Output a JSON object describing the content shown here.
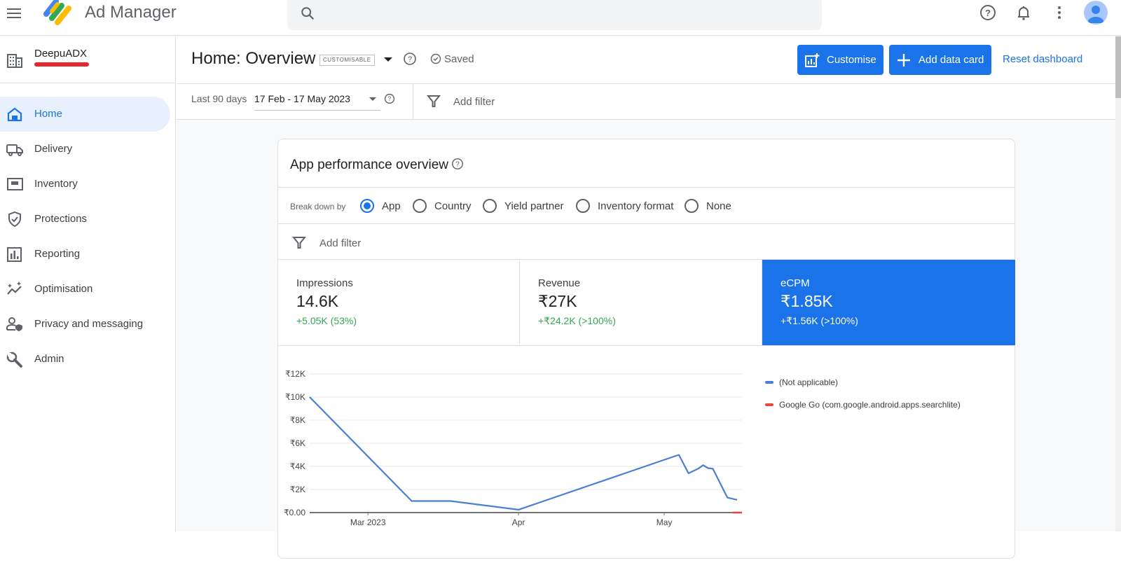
{
  "app": {
    "title": "Ad Manager",
    "search_placeholder": ""
  },
  "topbar": {
    "icons": [
      "menu-icon",
      "search-icon",
      "help-icon",
      "notifications-icon",
      "more-vert-icon",
      "account-avatar"
    ]
  },
  "account": {
    "name": "DeepuADX",
    "network_code": "[redacted]"
  },
  "sidebar": {
    "items": [
      {
        "label": "Home",
        "icon": "home-icon",
        "active": true
      },
      {
        "label": "Delivery",
        "icon": "truck-icon",
        "active": false
      },
      {
        "label": "Inventory",
        "icon": "inventory-icon",
        "active": false
      },
      {
        "label": "Protections",
        "icon": "shield-check-icon",
        "active": false
      },
      {
        "label": "Reporting",
        "icon": "bar-chart-icon",
        "active": false
      },
      {
        "label": "Optimisation",
        "icon": "sparkline-icon",
        "active": false
      },
      {
        "label": "Privacy and messaging",
        "icon": "privacy-person-icon",
        "active": false
      },
      {
        "label": "Admin",
        "icon": "wrench-icon",
        "active": false
      }
    ]
  },
  "header": {
    "title": "Home: Overview",
    "badge": "CUSTOMISABLE",
    "saved_label": "Saved",
    "customise_label": "Customise",
    "add_card_label": "Add data card",
    "reset_label": "Reset dashboard"
  },
  "filters": {
    "range_label": "Last 90 days",
    "range_value": "17 Feb - 17 May 2023",
    "add_filter": "Add filter"
  },
  "card": {
    "title": "App performance overview",
    "breakdown_label": "Break down by",
    "breakdown_options": [
      {
        "label": "App",
        "selected": true
      },
      {
        "label": "Country",
        "selected": false
      },
      {
        "label": "Yield partner",
        "selected": false
      },
      {
        "label": "Inventory format",
        "selected": false
      },
      {
        "label": "None",
        "selected": false
      }
    ],
    "add_filter": "Add filter",
    "metrics": [
      {
        "name": "Impressions",
        "value": "14.6K",
        "delta": "+5.05K (53%)",
        "selected": false
      },
      {
        "name": "Revenue",
        "value": "₹27K",
        "delta": "+₹24.2K (>100%)",
        "selected": false
      },
      {
        "name": "eCPM",
        "value": "₹1.85K",
        "delta": "+₹1.56K (>100%)",
        "selected": true
      }
    ]
  },
  "colors": {
    "accent": "#1a73e8",
    "positive": "#34a853",
    "series_blue": "#4a7fd4",
    "series_red": "#e8453c"
  },
  "chart_data": {
    "type": "line",
    "title": "eCPM",
    "xlabel": "",
    "ylabel": "",
    "x_ticks": [
      "Mar 2023",
      "Apr",
      "May"
    ],
    "y_ticks": [
      "₹0.00",
      "₹2K",
      "₹4K",
      "₹6K",
      "₹8K",
      "₹10K",
      "₹12K"
    ],
    "ylim": [
      0,
      12000
    ],
    "xlim": [
      "2023-02-17",
      "2023-05-17"
    ],
    "grid": true,
    "legend_position": "right",
    "series": [
      {
        "name": "(Not applicable)",
        "color": "#4a7fd4",
        "points": [
          {
            "date": "2023-02-17",
            "value": 10000
          },
          {
            "date": "2023-03-10",
            "value": 1000
          },
          {
            "date": "2023-03-18",
            "value": 1000
          },
          {
            "date": "2023-04-01",
            "value": 250
          },
          {
            "date": "2023-05-04",
            "value": 5000
          },
          {
            "date": "2023-05-06",
            "value": 3400
          },
          {
            "date": "2023-05-08",
            "value": 3800
          },
          {
            "date": "2023-05-09",
            "value": 4100
          },
          {
            "date": "2023-05-10",
            "value": 3850
          },
          {
            "date": "2023-05-11",
            "value": 3800
          },
          {
            "date": "2023-05-14",
            "value": 1300
          },
          {
            "date": "2023-05-16",
            "value": 1100
          }
        ]
      },
      {
        "name": "Google Go (com.google.android.apps.searchlite)",
        "color": "#e8453c",
        "points": [
          {
            "date": "2023-05-15",
            "value": 0
          },
          {
            "date": "2023-05-17",
            "value": 0
          }
        ]
      }
    ]
  }
}
